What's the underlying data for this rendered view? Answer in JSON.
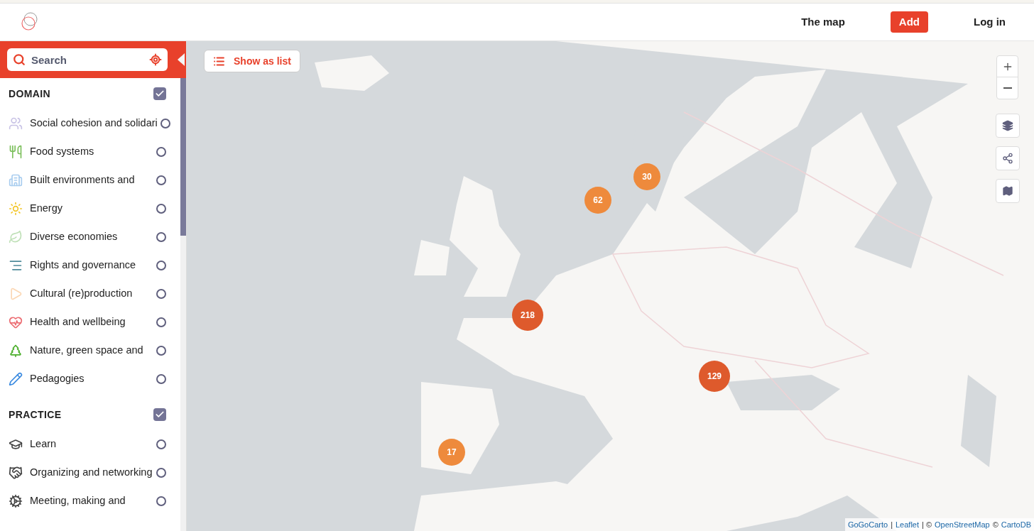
{
  "nav": [
    {
      "label": "The map",
      "kind": "link"
    },
    {
      "label": "Add",
      "kind": "primary"
    },
    {
      "label": "Log in",
      "kind": "link"
    }
  ],
  "search": {
    "placeholder": "Search"
  },
  "show_list": {
    "label": "Show as list"
  },
  "groups": [
    {
      "title": "DOMAIN",
      "checked": true,
      "items": [
        {
          "label": "Social cohesion and solidari",
          "checked": false
        },
        {
          "label": "Food systems",
          "checked": false
        },
        {
          "label": "Built environments and",
          "checked": false
        },
        {
          "label": "Energy",
          "checked": false
        },
        {
          "label": "Diverse economies",
          "checked": false
        },
        {
          "label": "Rights and governance",
          "checked": false
        },
        {
          "label": "Cultural (re)production",
          "checked": false
        },
        {
          "label": "Health and wellbeing",
          "checked": false
        },
        {
          "label": "Nature, green space and",
          "checked": false
        },
        {
          "label": "Pedagogies",
          "checked": false
        }
      ]
    },
    {
      "title": "PRACTICE",
      "checked": true,
      "items": [
        {
          "label": "Learn",
          "checked": false
        },
        {
          "label": "Organizing and networking",
          "checked": false
        },
        {
          "label": "Meeting, making and",
          "checked": false
        }
      ]
    }
  ],
  "markers": [
    {
      "count": "30",
      "color": "#ee8a3c"
    },
    {
      "count": "62",
      "color": "#ee8a3c"
    },
    {
      "count": "218",
      "color": "#de5a2c"
    },
    {
      "count": "129",
      "color": "#de5a2c"
    },
    {
      "count": "17",
      "color": "#ee8a3c"
    }
  ],
  "attribution": [
    {
      "label": "GoGoCarto",
      "kind": "link"
    },
    {
      "label": "|",
      "kind": "text"
    },
    {
      "label": "Leaflet",
      "kind": "link"
    },
    {
      "label": "| ©",
      "kind": "text"
    },
    {
      "label": "OpenStreetMap",
      "kind": "link"
    },
    {
      "label": "©",
      "kind": "text"
    },
    {
      "label": "CartoDB",
      "kind": "link"
    }
  ]
}
